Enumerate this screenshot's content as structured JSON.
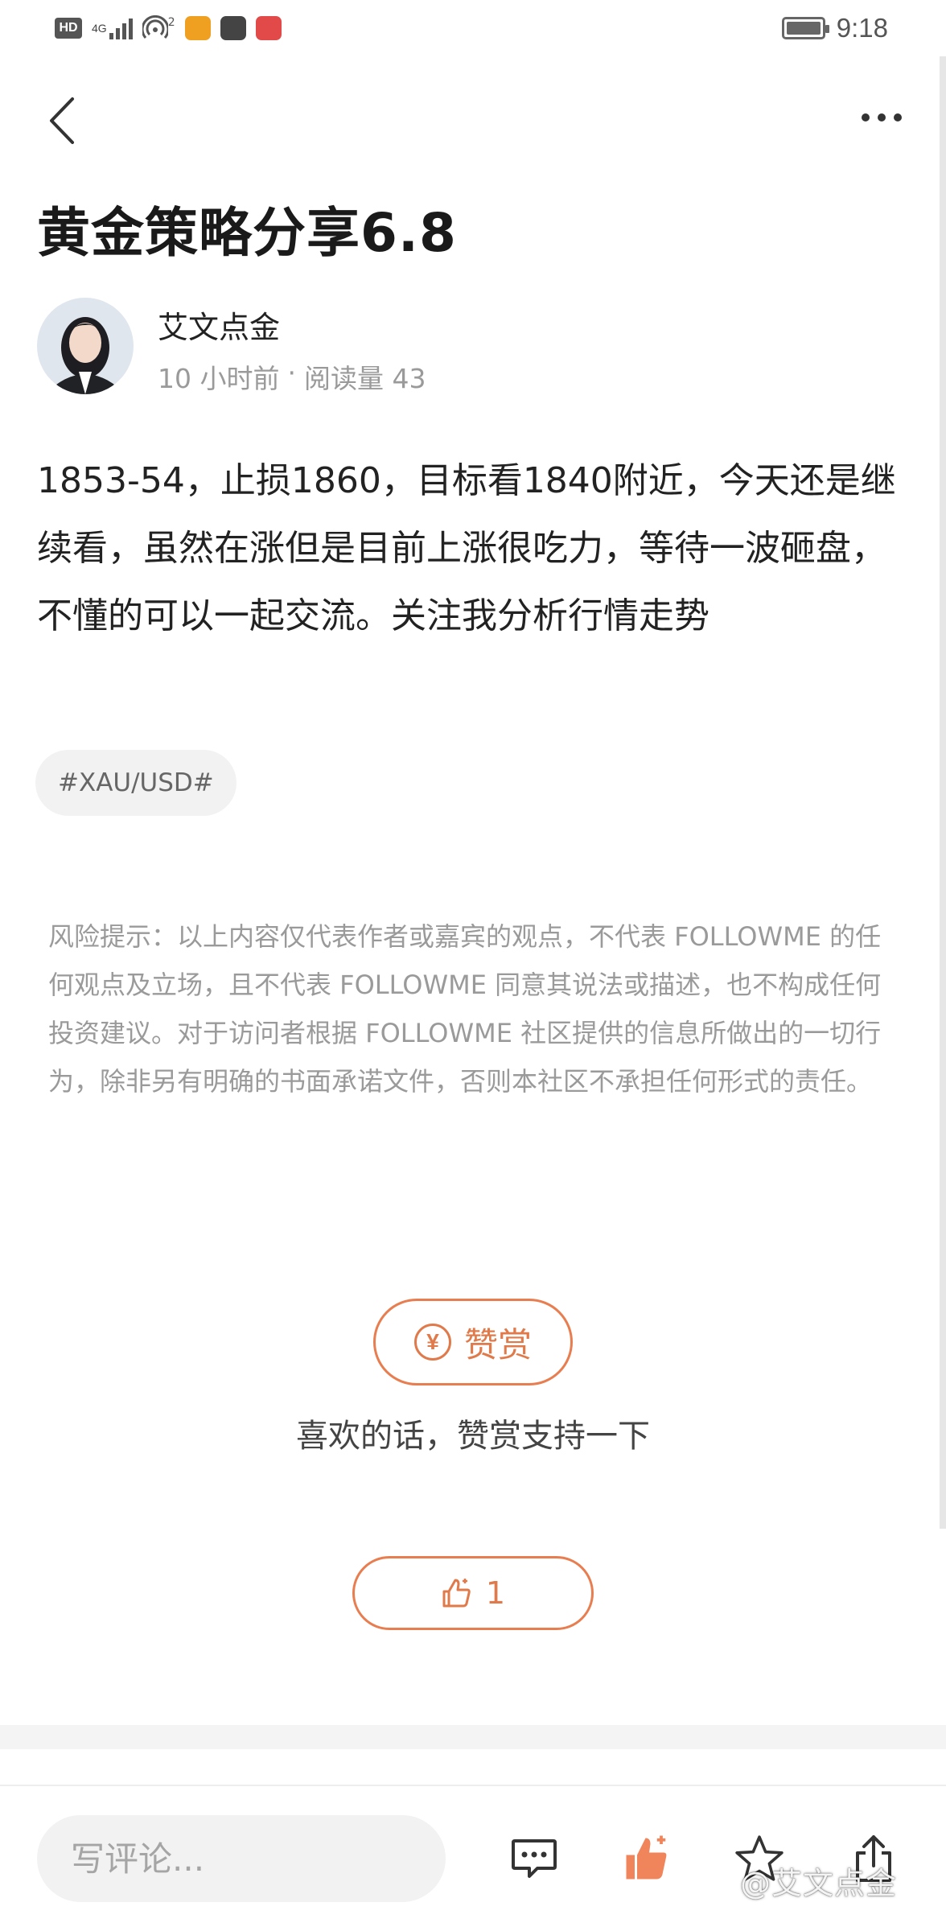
{
  "status_bar": {
    "left_labels": [
      "HD",
      "4G"
    ],
    "wifi_sup": "2",
    "time": "9:18"
  },
  "header": {
    "back_icon": "chevron-left-icon",
    "more_icon": "more-horizontal-icon"
  },
  "article": {
    "title": "黄金策略分享6.8",
    "author": {
      "name": "艾文点金",
      "time_ago": "10 小时前",
      "separator": "·",
      "reads": "阅读量 43"
    },
    "content": "1853-54，止损1860，目标看1840附近，今天还是继续看，虽然在涨但是目前上涨很吃力，等待一波砸盘，不懂的可以一起交流。关注我分析行情走势",
    "tag": "#XAU/USD#",
    "disclaimer": "风险提示：以上内容仅代表作者或嘉宾的观点，不代表 FOLLOWME 的任何观点及立场，且不代表 FOLLOWME 同意其说法或描述，也不构成任何投资建议。对于访问者根据 FOLLOWME 社区提供的信息所做出的一切行为，除非另有明确的书面承诺文件，否则本社区不承担任何形式的责任。"
  },
  "reward": {
    "button_label": "赞赏",
    "hint": "喜欢的话，赞赏支持一下"
  },
  "like": {
    "count": "1"
  },
  "bottom_bar": {
    "comment_placeholder": "写评论..."
  },
  "watermark": "@艾文点金",
  "colors": {
    "accent": "#e87d4f",
    "text": "#222222",
    "muted": "#9a9a9a",
    "chip_bg": "#f2f2f2"
  }
}
